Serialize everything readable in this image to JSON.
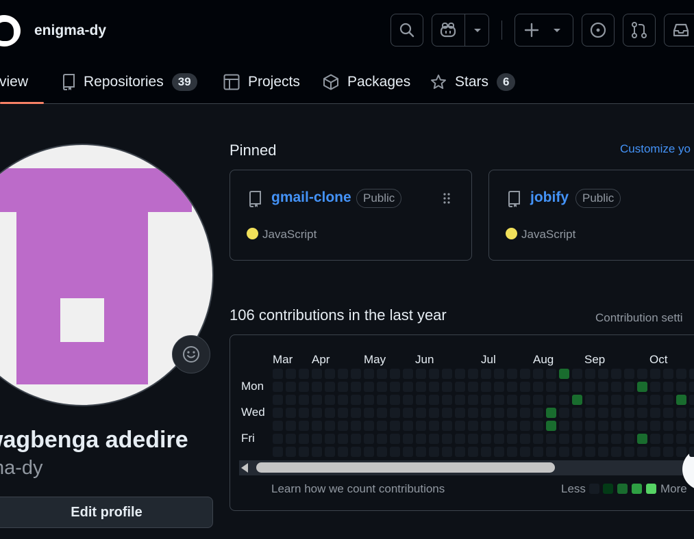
{
  "header": {
    "username": "enigma-dy",
    "icons": [
      "github-logo",
      "search-icon",
      "copilot-icon",
      "chevron-down-icon",
      "plus-icon",
      "issue-icon",
      "pull-request-icon",
      "inbox-icon"
    ]
  },
  "tabs": [
    {
      "label": "rview",
      "selected": true
    },
    {
      "label": "Repositories",
      "count": "39"
    },
    {
      "label": "Projects"
    },
    {
      "label": "Packages"
    },
    {
      "label": "Stars",
      "count": "6"
    }
  ],
  "profile": {
    "fullname": "wagbenga adedire",
    "login": "na-dy",
    "edit_label": "Edit profile"
  },
  "pinned": {
    "title": "Pinned",
    "customize": "Customize yo",
    "repos": [
      {
        "name": "gmail-clone",
        "visibility": "Public",
        "language": "JavaScript"
      },
      {
        "name": "jobify",
        "visibility": "Public",
        "language": "JavaScript"
      }
    ]
  },
  "contributions": {
    "title": "106 contributions in the last year",
    "settings": "Contribution setti",
    "months": [
      "Mar",
      "Apr",
      "May",
      "Jun",
      "Jul",
      "Aug",
      "Sep",
      "Oct"
    ],
    "days": [
      "Mon",
      "Wed",
      "Fri"
    ],
    "learn": "Learn how we count contributions",
    "less": "Less",
    "more": "More"
  },
  "colors": {
    "bg": "#0d1117",
    "accent": "#4493f8",
    "tab_underline": "#f78166",
    "js": "#f1e05a",
    "levels": [
      "#151b23",
      "#033a16",
      "#196c2e",
      "#2ea043",
      "#56d364"
    ]
  }
}
